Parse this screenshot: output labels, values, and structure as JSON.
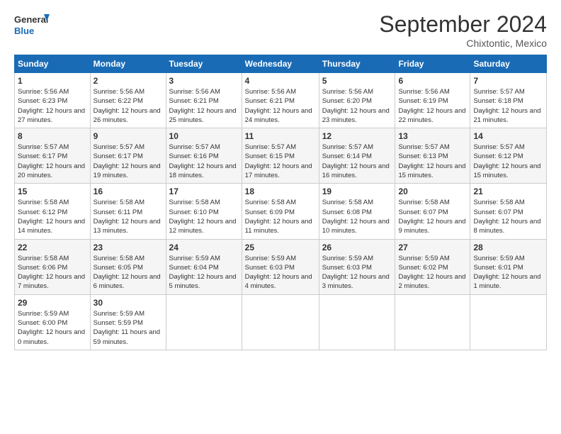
{
  "logo": {
    "line1": "General",
    "line2": "Blue"
  },
  "title": "September 2024",
  "location": "Chixtontic, Mexico",
  "days_of_week": [
    "Sunday",
    "Monday",
    "Tuesday",
    "Wednesday",
    "Thursday",
    "Friday",
    "Saturday"
  ],
  "weeks": [
    [
      {
        "day": "1",
        "sunrise": "5:56 AM",
        "sunset": "6:23 PM",
        "daylight": "12 hours and 27 minutes."
      },
      {
        "day": "2",
        "sunrise": "5:56 AM",
        "sunset": "6:22 PM",
        "daylight": "12 hours and 26 minutes."
      },
      {
        "day": "3",
        "sunrise": "5:56 AM",
        "sunset": "6:21 PM",
        "daylight": "12 hours and 25 minutes."
      },
      {
        "day": "4",
        "sunrise": "5:56 AM",
        "sunset": "6:21 PM",
        "daylight": "12 hours and 24 minutes."
      },
      {
        "day": "5",
        "sunrise": "5:56 AM",
        "sunset": "6:20 PM",
        "daylight": "12 hours and 23 minutes."
      },
      {
        "day": "6",
        "sunrise": "5:56 AM",
        "sunset": "6:19 PM",
        "daylight": "12 hours and 22 minutes."
      },
      {
        "day": "7",
        "sunrise": "5:57 AM",
        "sunset": "6:18 PM",
        "daylight": "12 hours and 21 minutes."
      }
    ],
    [
      {
        "day": "8",
        "sunrise": "5:57 AM",
        "sunset": "6:17 PM",
        "daylight": "12 hours and 20 minutes."
      },
      {
        "day": "9",
        "sunrise": "5:57 AM",
        "sunset": "6:17 PM",
        "daylight": "12 hours and 19 minutes."
      },
      {
        "day": "10",
        "sunrise": "5:57 AM",
        "sunset": "6:16 PM",
        "daylight": "12 hours and 18 minutes."
      },
      {
        "day": "11",
        "sunrise": "5:57 AM",
        "sunset": "6:15 PM",
        "daylight": "12 hours and 17 minutes."
      },
      {
        "day": "12",
        "sunrise": "5:57 AM",
        "sunset": "6:14 PM",
        "daylight": "12 hours and 16 minutes."
      },
      {
        "day": "13",
        "sunrise": "5:57 AM",
        "sunset": "6:13 PM",
        "daylight": "12 hours and 15 minutes."
      },
      {
        "day": "14",
        "sunrise": "5:57 AM",
        "sunset": "6:12 PM",
        "daylight": "12 hours and 15 minutes."
      }
    ],
    [
      {
        "day": "15",
        "sunrise": "5:58 AM",
        "sunset": "6:12 PM",
        "daylight": "12 hours and 14 minutes."
      },
      {
        "day": "16",
        "sunrise": "5:58 AM",
        "sunset": "6:11 PM",
        "daylight": "12 hours and 13 minutes."
      },
      {
        "day": "17",
        "sunrise": "5:58 AM",
        "sunset": "6:10 PM",
        "daylight": "12 hours and 12 minutes."
      },
      {
        "day": "18",
        "sunrise": "5:58 AM",
        "sunset": "6:09 PM",
        "daylight": "12 hours and 11 minutes."
      },
      {
        "day": "19",
        "sunrise": "5:58 AM",
        "sunset": "6:08 PM",
        "daylight": "12 hours and 10 minutes."
      },
      {
        "day": "20",
        "sunrise": "5:58 AM",
        "sunset": "6:07 PM",
        "daylight": "12 hours and 9 minutes."
      },
      {
        "day": "21",
        "sunrise": "5:58 AM",
        "sunset": "6:07 PM",
        "daylight": "12 hours and 8 minutes."
      }
    ],
    [
      {
        "day": "22",
        "sunrise": "5:58 AM",
        "sunset": "6:06 PM",
        "daylight": "12 hours and 7 minutes."
      },
      {
        "day": "23",
        "sunrise": "5:58 AM",
        "sunset": "6:05 PM",
        "daylight": "12 hours and 6 minutes."
      },
      {
        "day": "24",
        "sunrise": "5:59 AM",
        "sunset": "6:04 PM",
        "daylight": "12 hours and 5 minutes."
      },
      {
        "day": "25",
        "sunrise": "5:59 AM",
        "sunset": "6:03 PM",
        "daylight": "12 hours and 4 minutes."
      },
      {
        "day": "26",
        "sunrise": "5:59 AM",
        "sunset": "6:03 PM",
        "daylight": "12 hours and 3 minutes."
      },
      {
        "day": "27",
        "sunrise": "5:59 AM",
        "sunset": "6:02 PM",
        "daylight": "12 hours and 2 minutes."
      },
      {
        "day": "28",
        "sunrise": "5:59 AM",
        "sunset": "6:01 PM",
        "daylight": "12 hours and 1 minute."
      }
    ],
    [
      {
        "day": "29",
        "sunrise": "5:59 AM",
        "sunset": "6:00 PM",
        "daylight": "12 hours and 0 minutes."
      },
      {
        "day": "30",
        "sunrise": "5:59 AM",
        "sunset": "5:59 PM",
        "daylight": "11 hours and 59 minutes."
      },
      null,
      null,
      null,
      null,
      null
    ]
  ],
  "labels": {
    "sunrise": "Sunrise:",
    "sunset": "Sunset:",
    "daylight": "Daylight:"
  }
}
